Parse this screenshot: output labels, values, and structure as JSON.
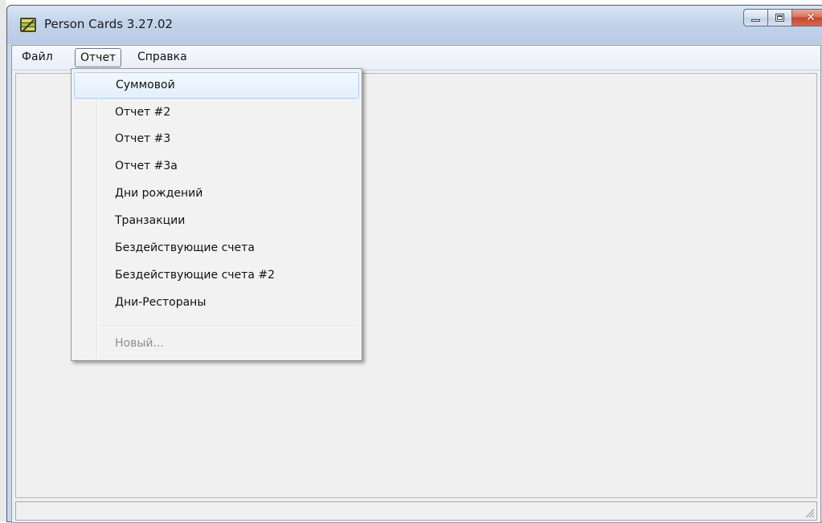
{
  "window": {
    "title": "Person Cards 3.27.02",
    "close_glyph": "✕"
  },
  "menubar": {
    "items": [
      {
        "label": "Файл"
      },
      {
        "label": "Отчет"
      },
      {
        "label": "Справка"
      }
    ]
  },
  "report_menu": {
    "items": [
      {
        "label": "Суммовой",
        "highlighted": true
      },
      {
        "label": "Отчет #2"
      },
      {
        "label": "Отчет #3"
      },
      {
        "label": "Отчет #3а"
      },
      {
        "label": "Дни рождений"
      },
      {
        "label": "Транзакции"
      },
      {
        "label": "Бездействующие счета"
      },
      {
        "label": "Бездействующие счета #2"
      },
      {
        "label": "Дни-Рестораны"
      }
    ],
    "disabled_item": {
      "label": "Новый..."
    }
  },
  "colors": {
    "highlight_border": "#aecff7",
    "close_button": "#c8472a",
    "disabled_text": "#8d8d8d"
  },
  "icons": {
    "app": "app-icon",
    "minimize": "minimize-icon",
    "maximize": "maximize-icon",
    "close": "close-icon",
    "grip": "resize-grip-icon"
  }
}
